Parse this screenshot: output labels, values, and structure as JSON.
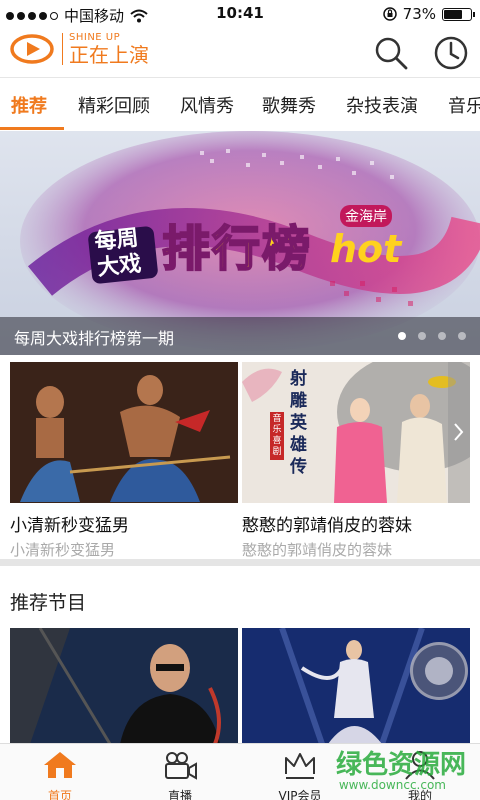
{
  "status": {
    "carrier": "中国移动",
    "time": "10:41",
    "battery": "73%",
    "battery_level": 0.73
  },
  "header": {
    "logo_en": "SHINE UP",
    "logo_cn": "正在上演",
    "search_icon": "search-icon",
    "history_icon": "clock-icon"
  },
  "tabs": [
    {
      "label": "推荐",
      "active": true
    },
    {
      "label": "精彩回顾"
    },
    {
      "label": "风情秀"
    },
    {
      "label": "歌舞秀"
    },
    {
      "label": "杂技表演"
    },
    {
      "label": "音乐"
    }
  ],
  "banner": {
    "title": "每周大戏排行榜第一期",
    "art_text": {
      "left": "每周大戏",
      "main": "排行榜",
      "hot": "hot",
      "tag": "金海岸"
    },
    "pages": 4,
    "current_page": 1
  },
  "cards": [
    {
      "title": "小清新秒变猛男",
      "subtitle": "小清新秒变猛男"
    },
    {
      "title": "憨憨的郭靖俏皮的蓉妹",
      "subtitle": "憨憨的郭靖俏皮的蓉妹",
      "poster_text": "射雕英雄传",
      "poster_tag": "音乐喜剧"
    }
  ],
  "section": {
    "title": "推荐节目"
  },
  "bottom_nav": [
    {
      "label": "首页",
      "icon": "home-icon",
      "active": true
    },
    {
      "label": "直播",
      "icon": "camera-icon"
    },
    {
      "label": "VIP会员",
      "icon": "crown-icon"
    },
    {
      "label": "我的",
      "icon": "user-icon"
    }
  ],
  "watermark": {
    "text": "绿色资源网",
    "url": "www.downcc.com"
  },
  "colors": {
    "accent": "#f07a1e"
  }
}
